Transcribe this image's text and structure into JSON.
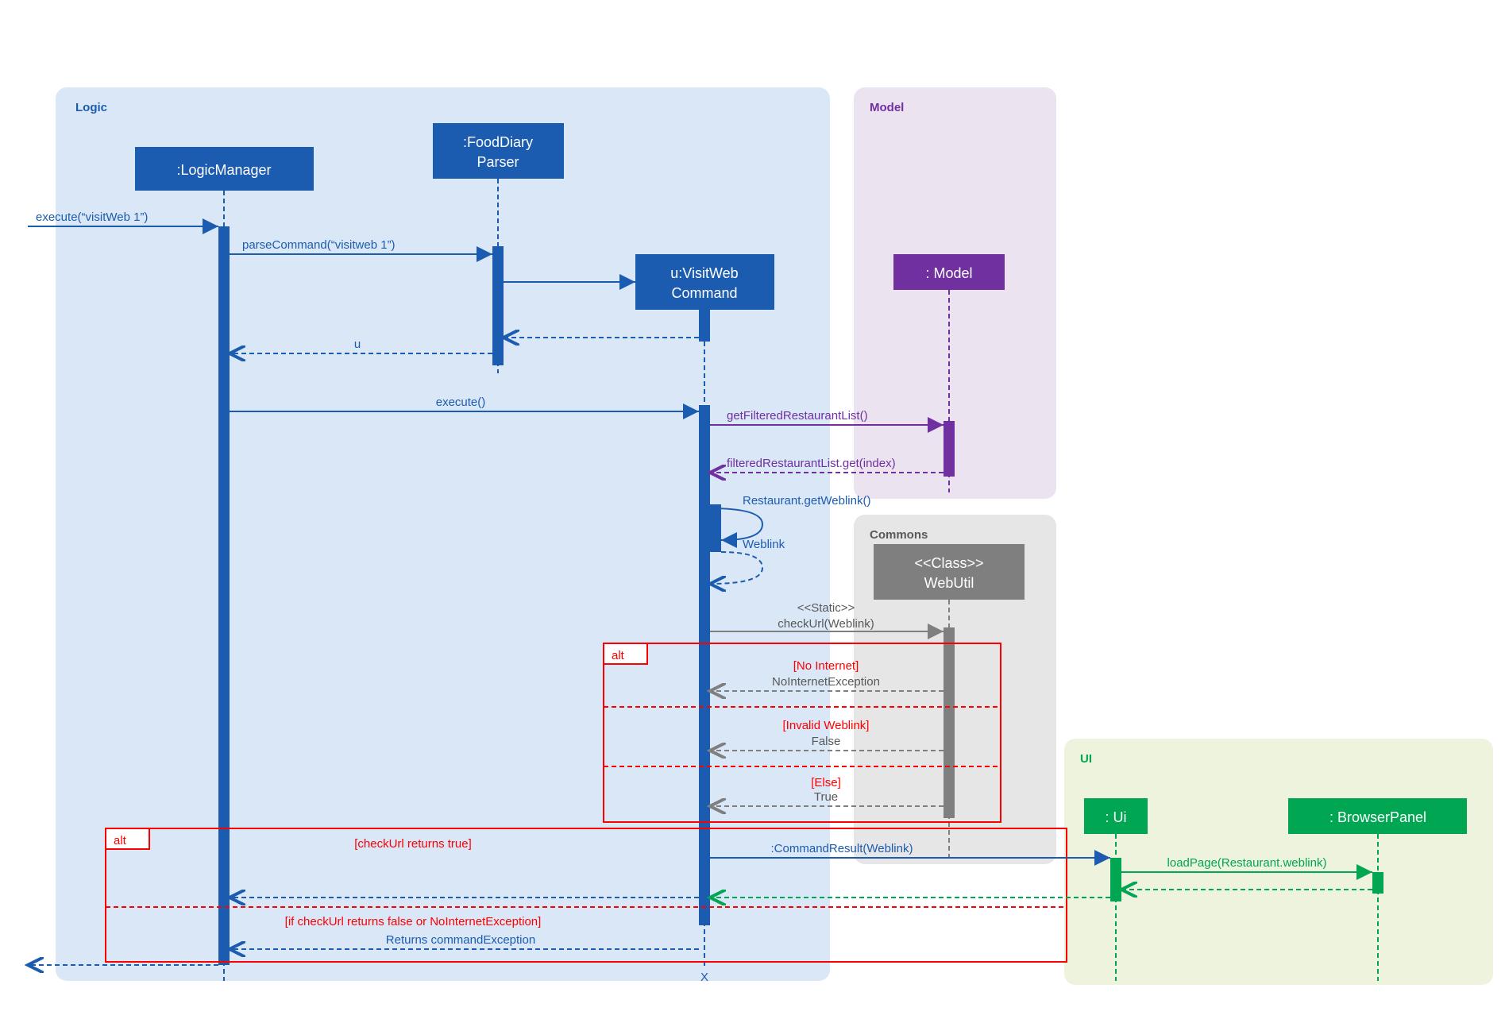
{
  "frames": {
    "logic": "Logic",
    "model": "Model",
    "commons": "Commons",
    "ui": "UI"
  },
  "lifelines": {
    "logicManager": ":LogicManager",
    "foodDiaryParser1": ":FoodDiary",
    "foodDiaryParser2": "Parser",
    "visitWebCmd1": "u:VisitWeb",
    "visitWebCmd2": "Command",
    "model": ": Model",
    "webUtil1": "<<Class>>",
    "webUtil2": "WebUtil",
    "ui": ": Ui",
    "browserPanel": ": BrowserPanel"
  },
  "messages": {
    "executeIn": "execute(“visitWeb 1”)",
    "parseCommand": "parseCommand(“visitweb 1”)",
    "return_u": "u",
    "execute": "execute()",
    "getFiltered": "getFilteredRestaurantList()",
    "filteredGet": "filteredRestaurantList.get(index)",
    "getWeblink": "Restaurant.getWeblink()",
    "weblinkReturn": "Weblink",
    "staticStereo": "<<Static>>",
    "checkUrl": "checkUrl(Weblink)",
    "noInternetGuard": "[No Internet]",
    "noInternetEx": "NoInternetException",
    "invalidGuard": "[Invalid Weblink]",
    "falseReturn": "False",
    "elseGuard": "[Else]",
    "trueReturn": "True",
    "cmdResult": ":CommandResult(Weblink)",
    "loadPage": "loadPage(Restaurant.weblink)",
    "alt2guard1": "[checkUrl returns true]",
    "alt2guard2": "[if checkUrl returns false or NoInternetException]",
    "returnsCmdEx": "Returns commandException",
    "altLabel": "alt",
    "destroy": "X"
  }
}
